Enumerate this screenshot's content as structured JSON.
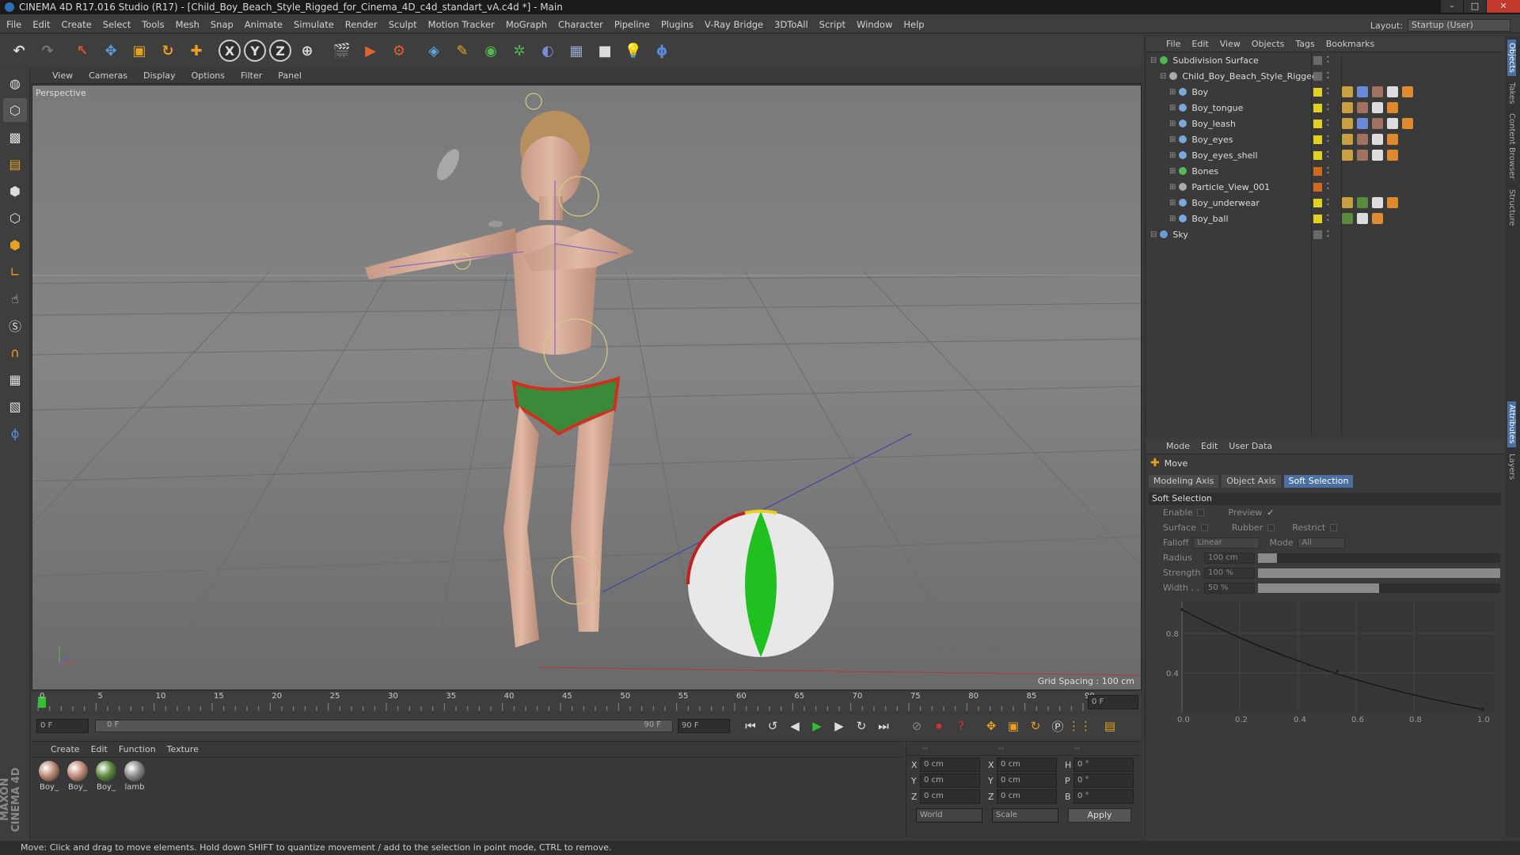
{
  "window": {
    "title": "CINEMA 4D R17.016 Studio (R17) - [Child_Boy_Beach_Style_Rigged_for_Cinema_4D_c4d_standart_vA.c4d *] - Main"
  },
  "menubar": [
    "File",
    "Edit",
    "Create",
    "Select",
    "Tools",
    "Mesh",
    "Snap",
    "Animate",
    "Simulate",
    "Render",
    "Sculpt",
    "Motion Tracker",
    "MoGraph",
    "Character",
    "Pipeline",
    "Plugins",
    "V-Ray Bridge",
    "3DToAll",
    "Script",
    "Window",
    "Help"
  ],
  "layout": {
    "label": "Layout:",
    "value": "Startup (User)"
  },
  "toolbar": {
    "axes": [
      "X",
      "Y",
      "Z"
    ]
  },
  "viewport": {
    "menu": [
      "View",
      "Cameras",
      "Display",
      "Options",
      "Filter",
      "Panel"
    ],
    "label": "Perspective",
    "grid_spacing": "Grid Spacing : 100 cm"
  },
  "timeline": {
    "ticks": [
      "0",
      "5",
      "10",
      "15",
      "20",
      "25",
      "30",
      "35",
      "40",
      "45",
      "50",
      "55",
      "60",
      "65",
      "70",
      "75",
      "80",
      "85",
      "90"
    ],
    "current_frame": "0 F",
    "start_field": "0 F",
    "range_start": "0 F",
    "range_end": "90 F",
    "end_field": "90 F"
  },
  "materials": {
    "menu": [
      "Create",
      "Edit",
      "Function",
      "Texture"
    ],
    "items": [
      {
        "label": "Boy_",
        "color": "#b88a72"
      },
      {
        "label": "Boy_",
        "color": "#c08c78"
      },
      {
        "label": "Boy_",
        "color": "#5a8a3c"
      },
      {
        "label": "lamb",
        "color": "#8a8a8a"
      }
    ]
  },
  "coordinates": {
    "header": [
      "--",
      "--",
      "--"
    ],
    "rows": [
      {
        "a": "X",
        "av": "0 cm",
        "b": "X",
        "bv": "0 cm",
        "c": "H",
        "cv": "0 °"
      },
      {
        "a": "Y",
        "av": "0 cm",
        "b": "Y",
        "bv": "0 cm",
        "c": "P",
        "cv": "0 °"
      },
      {
        "a": "Z",
        "av": "0 cm",
        "b": "Z",
        "bv": "0 cm",
        "c": "B",
        "cv": "0 °"
      }
    ],
    "world": "World",
    "scale": "Scale",
    "apply": "Apply"
  },
  "status": "Move: Click and drag to move elements. Hold down SHIFT to quantize movement / add to the selection in point mode, CTRL to remove.",
  "maxon": "MAXON CINEMA 4D",
  "objects": {
    "menu": [
      "File",
      "Edit",
      "View",
      "Objects",
      "Tags",
      "Bookmarks"
    ],
    "items": [
      {
        "name": "Subdivision Surface",
        "indent": 0,
        "color": "#4fb84f",
        "vis": "#6a6a6a",
        "tags": []
      },
      {
        "name": "Child_Boy_Beach_Style_Rigged",
        "indent": 1,
        "color": "#aaaaaa",
        "vis": "#6a6a6a",
        "tags": []
      },
      {
        "name": "Boy",
        "indent": 2,
        "color": "#7aa8d8",
        "vis": "#e0d020",
        "tags": [
          "#c8a040",
          "#6a8ad8",
          "#a07060",
          "#dddddd",
          "#e08a30"
        ]
      },
      {
        "name": "Boy_tongue",
        "indent": 2,
        "color": "#7aa8d8",
        "vis": "#e0d020",
        "tags": [
          "#c8a040",
          "#a07060",
          "#dddddd",
          "#e08a30"
        ]
      },
      {
        "name": "Boy_leash",
        "indent": 2,
        "color": "#7aa8d8",
        "vis": "#e0d020",
        "tags": [
          "#c8a040",
          "#6a8ad8",
          "#a07060",
          "#dddddd",
          "#e08a30"
        ]
      },
      {
        "name": "Boy_eyes",
        "indent": 2,
        "color": "#7aa8d8",
        "vis": "#e0d020",
        "tags": [
          "#c8a040",
          "#a07060",
          "#dddddd",
          "#e08a30"
        ]
      },
      {
        "name": "Boy_eyes_shell",
        "indent": 2,
        "color": "#7aa8d8",
        "vis": "#e0d020",
        "tags": [
          "#c8a040",
          "#a07060",
          "#dddddd",
          "#e08a30"
        ]
      },
      {
        "name": "Bones",
        "indent": 2,
        "color": "#5ab85a",
        "vis": "#d06a20",
        "tags": []
      },
      {
        "name": "Particle_View_001",
        "indent": 2,
        "color": "#aaaaaa",
        "vis": "#d06a20",
        "tags": []
      },
      {
        "name": "Boy_underwear",
        "indent": 2,
        "color": "#7aa8d8",
        "vis": "#e0d020",
        "tags": [
          "#c8a040",
          "#5a8a3c",
          "#dddddd",
          "#e08a30"
        ]
      },
      {
        "name": "Boy_ball",
        "indent": 2,
        "color": "#7aa8d8",
        "vis": "#e0d020",
        "tags": [
          "#5a8a3c",
          "#dddddd",
          "#e08a30"
        ]
      },
      {
        "name": "Sky",
        "indent": 0,
        "color": "#6a9ad8",
        "vis": "#6a6a6a",
        "tags": []
      }
    ]
  },
  "attributes": {
    "menu": [
      "Mode",
      "Edit",
      "User Data"
    ],
    "tool": "Move",
    "tabs": [
      "Modeling Axis",
      "Object Axis",
      "Soft Selection"
    ],
    "section": "Soft Selection",
    "enable": "Enable",
    "preview": "Preview",
    "preview_check": "✓",
    "surface": "Surface",
    "rubber": "Rubber",
    "restrict": "Restrict",
    "falloff": "Falloff",
    "falloff_value": "Linear",
    "mode": "Mode",
    "mode_value": "All",
    "radius": "Radius",
    "radius_value": "100 cm",
    "radius_fill": 0.08,
    "strength": "Strength",
    "strength_value": "100 %",
    "strength_fill": 1.0,
    "width": "Width . .",
    "width_value": "50 %",
    "width_fill": 0.5,
    "curve_y_ticks": [
      "0.8",
      "0.4"
    ],
    "curve_x_ticks": [
      "0.0",
      "0.2",
      "0.4",
      "0.6",
      "0.8",
      "1.0"
    ]
  },
  "side_tabs": [
    "Objects",
    "Takes",
    "Content Browser",
    "Structure",
    "Attributes",
    "Layers"
  ]
}
